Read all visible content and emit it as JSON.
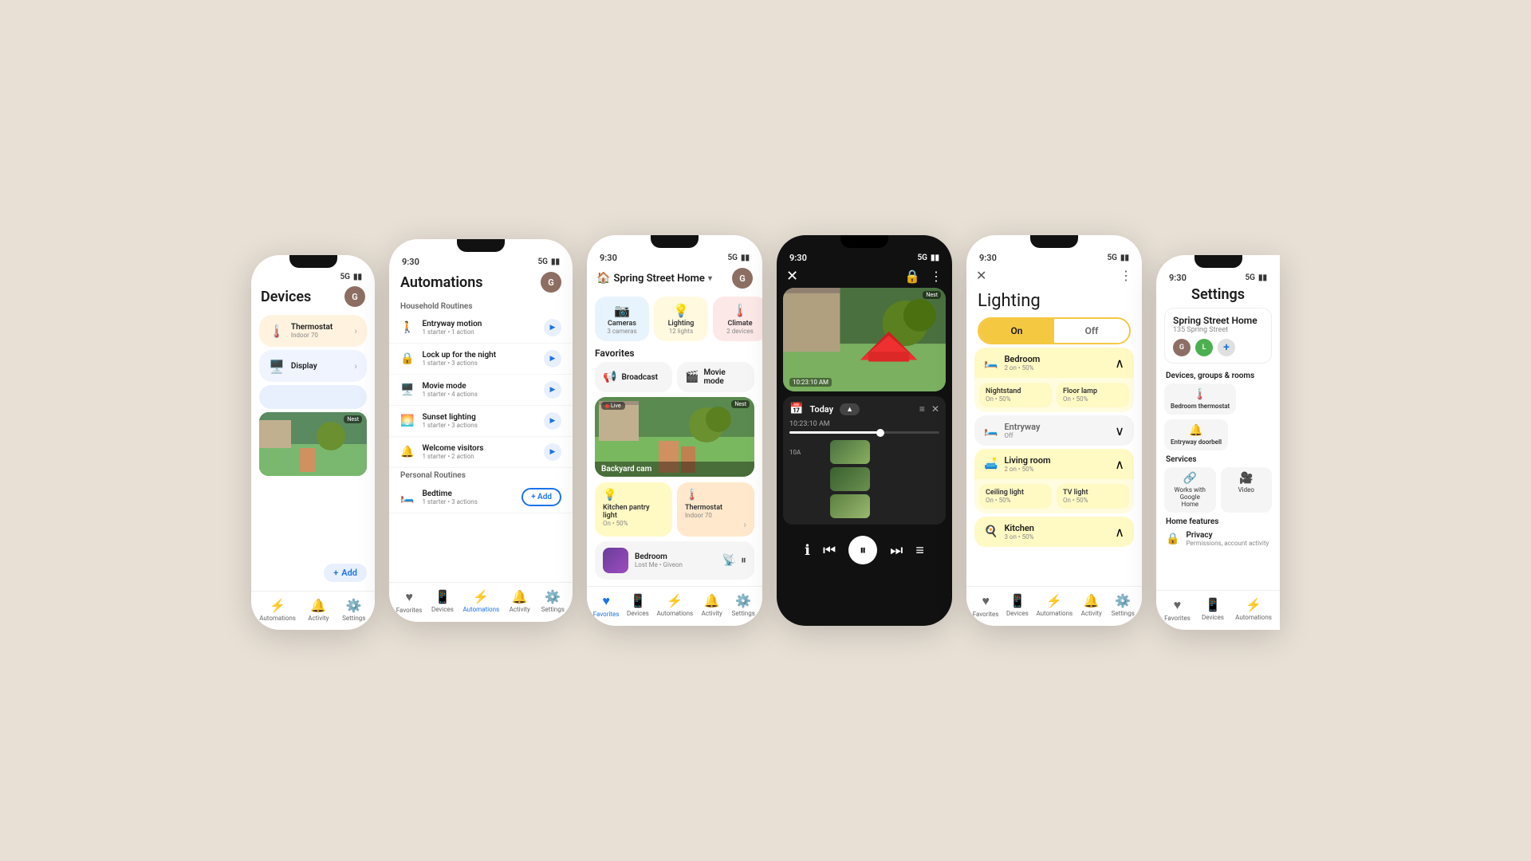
{
  "phones": [
    {
      "id": "p1",
      "type": "light",
      "statusBar": {
        "time": "",
        "signal": "5G",
        "battery": "▮▮▮"
      },
      "header": {
        "title": "Devices"
      },
      "devices": [
        {
          "icon": "🌡️",
          "name": "Thermostat",
          "sub": "Indoor 70",
          "color": "orange"
        },
        {
          "icon": "🖥️",
          "name": "Display",
          "sub": "",
          "color": "blue"
        }
      ],
      "camera": {
        "label": "Nest",
        "overlay": ""
      },
      "addButton": "Add",
      "nav": [
        {
          "icon": "★",
          "label": "Automations",
          "active": false
        },
        {
          "icon": "🔔",
          "label": "Activity",
          "active": false
        },
        {
          "icon": "⚙️",
          "label": "Settings",
          "active": false
        }
      ]
    },
    {
      "id": "p2",
      "type": "light",
      "statusBar": {
        "time": "9:30",
        "signal": "5G",
        "battery": "▮▮▮"
      },
      "header": {
        "title": "Automations"
      },
      "sections": [
        {
          "label": "Household Routines",
          "routines": [
            {
              "icon": "🚶",
              "name": "Entryway motion",
              "sub": "1 starter • 1 action"
            },
            {
              "icon": "🔒",
              "name": "Lock up for the night",
              "sub": "1 starter • 3 actions"
            },
            {
              "icon": "🎬",
              "name": "Movie mode",
              "sub": "1 starter • 4 actions"
            },
            {
              "icon": "💡",
              "name": "Sunset lighting",
              "sub": "1 starter • 3 actions"
            },
            {
              "icon": "👋",
              "name": "Welcome visitors",
              "sub": "1 starter • 2 action"
            }
          ]
        },
        {
          "label": "Personal Routines",
          "routines": [
            {
              "icon": "🛏️",
              "name": "Bedtime",
              "sub": "1 starter • 3 actions"
            }
          ]
        }
      ],
      "nav": [
        {
          "icon": "♥",
          "label": "Favorites",
          "active": false
        },
        {
          "icon": "📱",
          "label": "Devices",
          "active": false
        },
        {
          "icon": "⚡",
          "label": "Automations",
          "active": true
        },
        {
          "icon": "🔔",
          "label": "Activity",
          "active": false
        },
        {
          "icon": "⚙️",
          "label": "Settings",
          "active": false
        }
      ]
    },
    {
      "id": "p3",
      "type": "light",
      "statusBar": {
        "time": "9:30",
        "signal": "5G",
        "battery": "▮▮▮"
      },
      "header": {
        "homeName": "Spring Street Home"
      },
      "categories": [
        {
          "icon": "📷",
          "name": "Cameras",
          "count": "3 cameras",
          "color": "blue"
        },
        {
          "icon": "💡",
          "name": "Lighting",
          "count": "12 lights",
          "color": "yellow"
        },
        {
          "icon": "🌡️",
          "name": "Climate",
          "count": "2 devices",
          "color": "red"
        }
      ],
      "favorites": [
        {
          "icon": "📢",
          "label": "Broadcast"
        },
        {
          "icon": "🎬",
          "label": "Movie mode"
        }
      ],
      "camera": {
        "name": "Backyard cam",
        "live": true
      },
      "deviceRows": [
        [
          {
            "icon": "💡",
            "name": "Kitchen pantry light",
            "sub": "On • 50%",
            "color": "yellow"
          },
          {
            "icon": "🌡️",
            "name": "Thermostat",
            "sub": "Indoor 70",
            "color": "orange"
          }
        ],
        [
          {
            "icon": "🎵",
            "name": "Bedroom",
            "sub": "Lost Me • Giveon",
            "music": true
          }
        ]
      ],
      "nav": [
        {
          "icon": "♥",
          "label": "Favorites",
          "active": true
        },
        {
          "icon": "📱",
          "label": "Devices",
          "active": false
        },
        {
          "icon": "⚡",
          "label": "Automations",
          "active": false
        },
        {
          "icon": "🔔",
          "label": "Activity",
          "active": false
        },
        {
          "icon": "⚙️",
          "label": "Settings",
          "active": false
        }
      ]
    },
    {
      "id": "p4",
      "type": "dark",
      "statusBar": {
        "time": "9:30",
        "signal": "5G",
        "battery": "▮▮▮"
      },
      "camera": {
        "timestamp": "10:23:10 AM"
      },
      "timeline": {
        "title": "Today",
        "clips": [
          {
            "time": "10:23:10 AM"
          },
          {
            "time": ""
          },
          {
            "time": ""
          }
        ]
      },
      "controls": [
        "ℹ️",
        "⏮",
        "⏸",
        "⏭",
        "≡"
      ]
    },
    {
      "id": "p5",
      "type": "light",
      "statusBar": {
        "time": "9:30",
        "signal": "5G",
        "battery": "▮▮▮"
      },
      "title": "Lighting",
      "toggle": {
        "on": "On",
        "off": "Off"
      },
      "rooms": [
        {
          "name": "Bedroom",
          "sub": "2 on • 50%",
          "expanded": true,
          "lights": [
            {
              "name": "Nightstand",
              "status": "On • 50%"
            },
            {
              "name": "Floor lamp",
              "status": "On • 50%"
            }
          ]
        },
        {
          "name": "Entryway",
          "sub": "Off",
          "expanded": false,
          "lights": []
        },
        {
          "name": "Living room",
          "sub": "2 on • 50%",
          "expanded": true,
          "lights": [
            {
              "name": "Ceiling light",
              "status": "On • 50%"
            },
            {
              "name": "TV light",
              "status": "On • 50%"
            }
          ]
        },
        {
          "name": "Kitchen",
          "sub": "3 on • 50%",
          "expanded": true,
          "lights": []
        }
      ],
      "nav": [
        {
          "icon": "♥",
          "label": "Favorites",
          "active": false
        },
        {
          "icon": "📱",
          "label": "Devices",
          "active": false
        },
        {
          "icon": "⚡",
          "label": "Automations",
          "active": false
        },
        {
          "icon": "🔔",
          "label": "Activity",
          "active": false
        },
        {
          "icon": "⚙️",
          "label": "Settings",
          "active": false
        }
      ]
    },
    {
      "id": "p6",
      "type": "light",
      "statusBar": {
        "time": "9:30",
        "signal": "5G",
        "battery": "▮▮▮"
      },
      "title": "Settings",
      "home": {
        "name": "Spring Street Home",
        "address": "135 Spring Street"
      },
      "members": [
        {
          "initial": "G",
          "color": "#8d6e63"
        },
        {
          "initial": "L",
          "color": "#4caf50"
        }
      ],
      "sections": {
        "devicesGroupsRooms": {
          "label": "Devices, groups & rooms",
          "items": [
            {
              "icon": "🌡️",
              "name": "Bedroom thermostat"
            },
            {
              "icon": "🔔",
              "name": "Entryway doorbell"
            }
          ]
        },
        "services": {
          "label": "Services",
          "items": [
            {
              "icon": "🔗",
              "name": "Works with Google Home"
            },
            {
              "icon": "🎥",
              "name": "Video"
            }
          ]
        },
        "homeFeatures": {
          "label": "Home features",
          "items": [
            {
              "icon": "🔒",
              "name": "Privacy",
              "sub": "Permissions, account activity"
            }
          ]
        }
      },
      "nav": [
        {
          "icon": "♥",
          "label": "Favorites",
          "active": false
        },
        {
          "icon": "📱",
          "label": "Devices",
          "active": false
        },
        {
          "icon": "⚡",
          "label": "Automations",
          "active": false
        }
      ]
    }
  ]
}
